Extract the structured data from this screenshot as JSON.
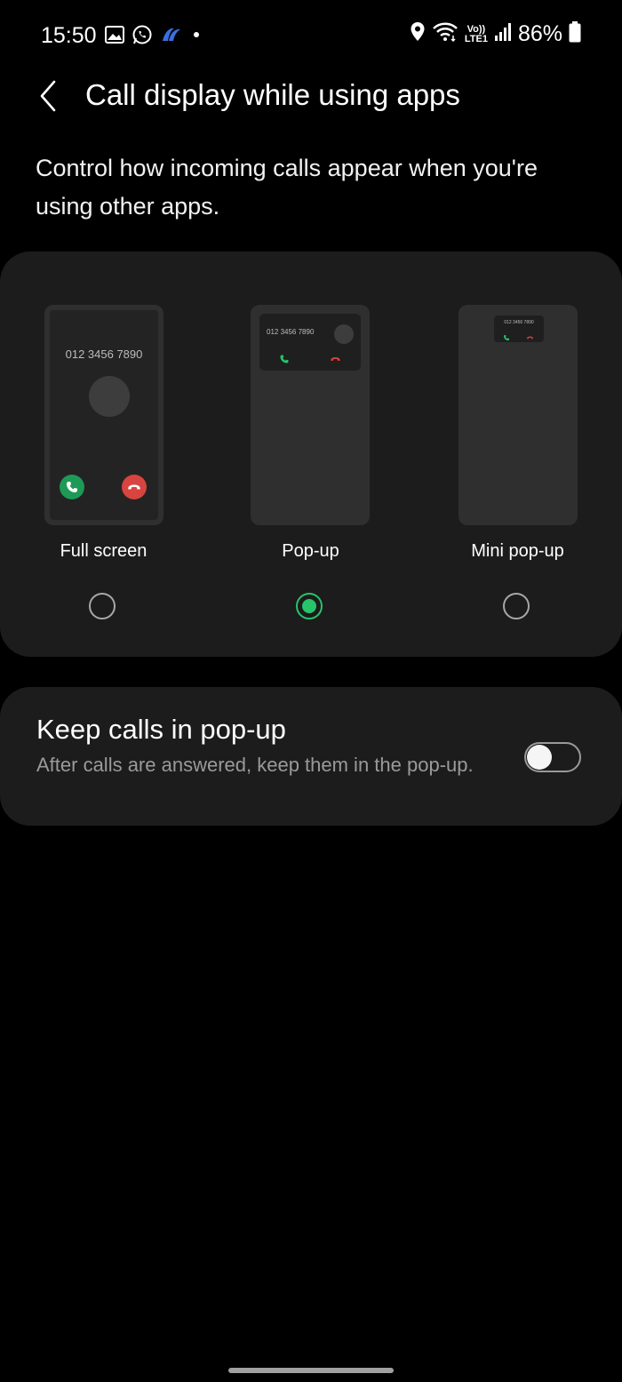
{
  "status_bar": {
    "time": "15:50",
    "battery": "86%",
    "volte_top": "Vo))",
    "volte_bottom": "LTE1",
    "icons_left": [
      "gallery-icon",
      "whatsapp-icon",
      "app-notification-icon",
      "dot-icon"
    ],
    "icons_right": [
      "location-icon",
      "wifi-icon",
      "volte-icon",
      "signal-icon",
      "battery-icon"
    ]
  },
  "header": {
    "title": "Call display while using apps"
  },
  "description": "Control how incoming calls appear when you're using other apps.",
  "options": [
    {
      "label": "Full screen",
      "selected": false,
      "number": "012 3456 7890"
    },
    {
      "label": "Pop-up",
      "selected": true,
      "number": "012 3456 7890"
    },
    {
      "label": "Mini pop-up",
      "selected": false,
      "number": "012 3456 7890"
    }
  ],
  "keep_calls": {
    "title": "Keep calls in pop-up",
    "subtitle": "After calls are answered, keep them in the pop-up.",
    "enabled": false
  },
  "colors": {
    "background": "#000000",
    "card": "#1c1c1c",
    "accent_green": "#27c46a",
    "answer_green": "#1d9a55",
    "decline_red": "#d8443f"
  }
}
